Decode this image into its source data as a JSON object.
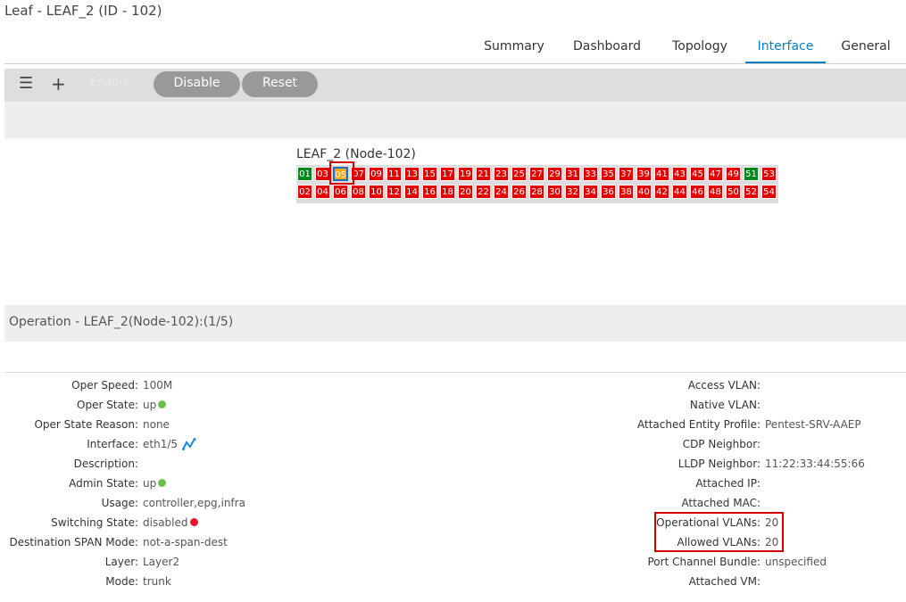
{
  "page": {
    "title": "Leaf - LEAF_2 (ID - 102)"
  },
  "tabs": [
    {
      "label": "Summary"
    },
    {
      "label": "Dashboard"
    },
    {
      "label": "Topology"
    },
    {
      "label": "Interface",
      "active": true
    },
    {
      "label": "General"
    }
  ],
  "toolbar": {
    "menu_icon": "menu-icon",
    "add_icon": "plus-icon",
    "enable_label": "Enable",
    "disable_label": "Disable",
    "reset_label": "Reset"
  },
  "switch": {
    "title": "LEAF_2 (Node-102)",
    "top_row": [
      "01",
      "03",
      "05",
      "07",
      "09",
      "11",
      "13",
      "15",
      "17",
      "19",
      "21",
      "23",
      "25",
      "27",
      "29",
      "31",
      "33",
      "35",
      "37",
      "39",
      "41",
      "43",
      "45",
      "47",
      "49",
      "51",
      "53"
    ],
    "bottom_row": [
      "02",
      "04",
      "06",
      "08",
      "10",
      "12",
      "14",
      "16",
      "18",
      "20",
      "22",
      "24",
      "26",
      "28",
      "30",
      "32",
      "34",
      "36",
      "38",
      "40",
      "42",
      "44",
      "46",
      "48",
      "50",
      "52",
      "54"
    ],
    "up_ports": [
      "01",
      "51"
    ],
    "selected_port": "05",
    "colors": {
      "down": "#e40000",
      "up": "#00881c",
      "selected": "#f5a800"
    }
  },
  "operation": {
    "title": "Operation - LEAF_2(Node-102):(1/5)",
    "left": [
      {
        "key": "Oper Speed:",
        "value": "100M"
      },
      {
        "key": "Oper State:",
        "value": "up",
        "status": "green"
      },
      {
        "key": "Oper State Reason:",
        "value": "none"
      },
      {
        "key": "Interface:",
        "value": "eth1/5",
        "icon": "topology-chart-icon"
      },
      {
        "key": "Description:",
        "value": ""
      },
      {
        "key": "Admin State:",
        "value": "up",
        "status": "green"
      },
      {
        "key": "Usage:",
        "value": "controller,epg,infra"
      },
      {
        "key": "Switching State:",
        "value": "disabled",
        "status": "red"
      },
      {
        "key": "Destination SPAN Mode:",
        "value": "not-a-span-dest"
      },
      {
        "key": "Layer:",
        "value": "Layer2"
      },
      {
        "key": "Mode:",
        "value": "trunk"
      }
    ],
    "right": [
      {
        "key": "Access VLAN:",
        "value": ""
      },
      {
        "key": "Native VLAN:",
        "value": ""
      },
      {
        "key": "Attached Entity Profile:",
        "value": "Pentest-SRV-AAEP"
      },
      {
        "key": "CDP Neighbor:",
        "value": ""
      },
      {
        "key": "LLDP Neighbor:",
        "value": "11:22:33:44:55:66"
      },
      {
        "key": "Attached IP:",
        "value": ""
      },
      {
        "key": "Attached MAC:",
        "value": ""
      },
      {
        "key": "Operational VLANs:",
        "value": "20"
      },
      {
        "key": "Allowed VLANs:",
        "value": "20"
      },
      {
        "key": "Port Channel Bundle:",
        "value": "unspecified"
      },
      {
        "key": "Attached VM:",
        "value": ""
      }
    ]
  }
}
